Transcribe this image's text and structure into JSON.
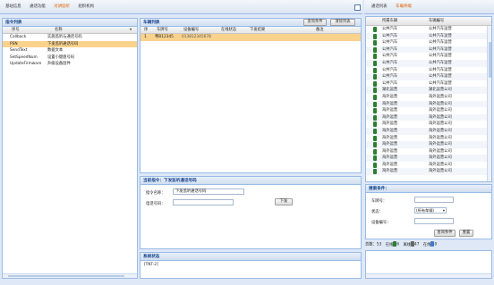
{
  "toolbar": {
    "buttons": [
      {
        "label": "基站信息"
      },
      {
        "label": "通话功能"
      },
      {
        "label": "对讲监听"
      },
      {
        "label": "组织机构"
      }
    ],
    "right_buttons": [
      {
        "label": "通话列表"
      },
      {
        "label": "车载终端"
      }
    ]
  },
  "commands": {
    "title": "指令列表",
    "col_index": "序号",
    "col_name": "名称",
    "items": [
      {
        "code": "Callback",
        "name": "实施监听与通话号码"
      },
      {
        "code": "PSN",
        "name": "下发监听通话号码"
      },
      {
        "code": "SendText",
        "name": "数据文本"
      },
      {
        "code": "SetSpeedNum",
        "name": "设置小键盘号码"
      },
      {
        "code": "UpdateFirmware",
        "name": "升级设备固件"
      }
    ]
  },
  "terminals": {
    "title": "车辆列表",
    "query_btn": "查询条件",
    "clear_btn": "清除列表",
    "columns": [
      "序",
      "车牌号",
      "设备编号",
      "在线状态",
      "下发结果",
      "备注"
    ],
    "rows": [
      {
        "idx": "1",
        "plate": "粤B12345",
        "device": "013812345678"
      }
    ]
  },
  "cmd_form": {
    "title": "当前指令：下发监听通话号码",
    "name_label": "指令名称：",
    "name_value": "下发监听通话号码",
    "phone_label": "电话号码：",
    "send_btn": "下发"
  },
  "log": {
    "title": "系统状态",
    "line": "[TNT-2]"
  },
  "vehicles": {
    "col_a": "所属车辆",
    "col_b": "车辆编号",
    "rows": [
      {
        "a": "公共汽车",
        "b": "公共汽车运营"
      },
      {
        "a": "公共汽车",
        "b": "公共汽车运营"
      },
      {
        "a": "公共汽车",
        "b": "公共汽车运营"
      },
      {
        "a": "公共汽车",
        "b": "公共汽车运营"
      },
      {
        "a": "公共汽车",
        "b": "公共汽车运营"
      },
      {
        "a": "公共汽车",
        "b": "公共汽车运营"
      },
      {
        "a": "公共汽车",
        "b": "公共汽车运营"
      },
      {
        "a": "公共汽车",
        "b": "公共汽车运营"
      },
      {
        "a": "公共汽车",
        "b": "公共汽车运营"
      },
      {
        "a": "湖北运营",
        "b": "湖北运营公司"
      },
      {
        "a": "海外运营",
        "b": "海外运营公司"
      },
      {
        "a": "海外运营",
        "b": "海外运营公司"
      },
      {
        "a": "海外运营",
        "b": "海外运营公司"
      },
      {
        "a": "海外运营",
        "b": "海外运营公司"
      },
      {
        "a": "海外运营",
        "b": "海外运营公司"
      },
      {
        "a": "海外运营",
        "b": "海外运营公司"
      },
      {
        "a": "海外运营",
        "b": "海外运营公司"
      },
      {
        "a": "海外运营",
        "b": "海外运营公司"
      },
      {
        "a": "海外运营",
        "b": "海外运营公司"
      },
      {
        "a": "海外运营",
        "b": "海外运营公司"
      },
      {
        "a": "海外运营",
        "b": "海外运营公司"
      },
      {
        "a": "海外运营",
        "b": "海外运营公司"
      }
    ]
  },
  "query": {
    "title": "搜索条件：",
    "plate_label": "车牌号：",
    "status_label": "状态：",
    "status_value": "(所有车辆)",
    "device_label": "设备编号：",
    "search_btn": "查询条件",
    "reset_btn": "重置"
  },
  "stats": {
    "total_label": "总数：",
    "total": "53",
    "online_label": "在线",
    "online": "6",
    "offline_label": "离线",
    "offline": "47",
    "other_label": "在线",
    "other": "0"
  },
  "colors": {
    "accent": "#e06000",
    "selection": "#f9d28c",
    "header": "#15428b",
    "border": "#99bbe8"
  }
}
